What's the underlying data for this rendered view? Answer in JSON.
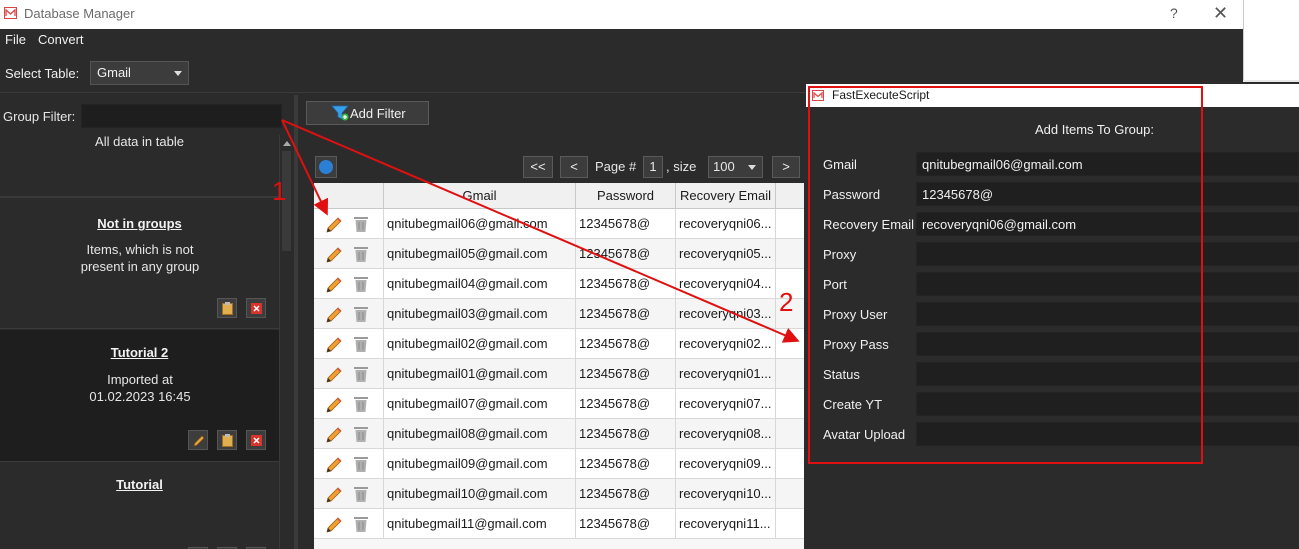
{
  "window": {
    "title": "Database Manager",
    "help": "?",
    "close": "✕"
  },
  "menu": [
    "File",
    "Convert"
  ],
  "toolbar": {
    "select_label": "Select Table:",
    "table_value": "Gmail"
  },
  "left": {
    "group_filter_label": "Group Filter:",
    "group_filter_value": "",
    "groups": [
      {
        "title": "",
        "desc": "All data in table"
      },
      {
        "title": "Not in groups",
        "desc": "Items, which is not present in any group"
      },
      {
        "title": "Tutorial 2",
        "desc": "Imported at 01.02.2023 16:45"
      },
      {
        "title": "Tutorial",
        "desc": ""
      }
    ]
  },
  "center": {
    "add_filter": "Add Filter",
    "pager": {
      "first": "<<",
      "prev": "<",
      "page_label": "Page #",
      "page": "1",
      "size_label": ", size",
      "size": "100",
      "next": ">"
    },
    "columns": [
      "Gmail",
      "Password",
      "Recovery Email"
    ],
    "rows": [
      [
        "qnitubegmail06@gmail.com",
        "12345678@",
        "recoveryqni06..."
      ],
      [
        "qnitubegmail05@gmail.com",
        "12345678@",
        "recoveryqni05..."
      ],
      [
        "qnitubegmail04@gmail.com",
        "12345678@",
        "recoveryqni04..."
      ],
      [
        "qnitubegmail03@gmail.com",
        "12345678@",
        "recoveryqni03..."
      ],
      [
        "qnitubegmail02@gmail.com",
        "12345678@",
        "recoveryqni02..."
      ],
      [
        "qnitubegmail01@gmail.com",
        "12345678@",
        "recoveryqni01..."
      ],
      [
        "qnitubegmail07@gmail.com",
        "12345678@",
        "recoveryqni07..."
      ],
      [
        "qnitubegmail08@gmail.com",
        "12345678@",
        "recoveryqni08..."
      ],
      [
        "qnitubegmail09@gmail.com",
        "12345678@",
        "recoveryqni09..."
      ],
      [
        "qnitubegmail10@gmail.com",
        "12345678@",
        "recoveryqni10..."
      ],
      [
        "qnitubegmail11@gmail.com",
        "12345678@",
        "recoveryqni11..."
      ]
    ]
  },
  "popup": {
    "title": "FastExecuteScript",
    "heading": "Add Items To Group:",
    "fields": [
      {
        "label": "Gmail",
        "value": "qnitubegmail06@gmail.com"
      },
      {
        "label": "Password",
        "value": "12345678@"
      },
      {
        "label": "Recovery Email",
        "value": "recoveryqni06@gmail.com"
      },
      {
        "label": "Proxy",
        "value": ""
      },
      {
        "label": "Port",
        "value": ""
      },
      {
        "label": "Proxy User",
        "value": ""
      },
      {
        "label": "Proxy Pass",
        "value": ""
      },
      {
        "label": "Status",
        "value": ""
      },
      {
        "label": "Create YT",
        "value": ""
      },
      {
        "label": "Avatar Upload",
        "value": ""
      }
    ]
  },
  "annotations": {
    "one": "1",
    "two": "2"
  },
  "colors": {
    "accent_red": "#e01010",
    "dark_bg": "#2b2b2b",
    "input_bg": "#1f1f1f"
  }
}
